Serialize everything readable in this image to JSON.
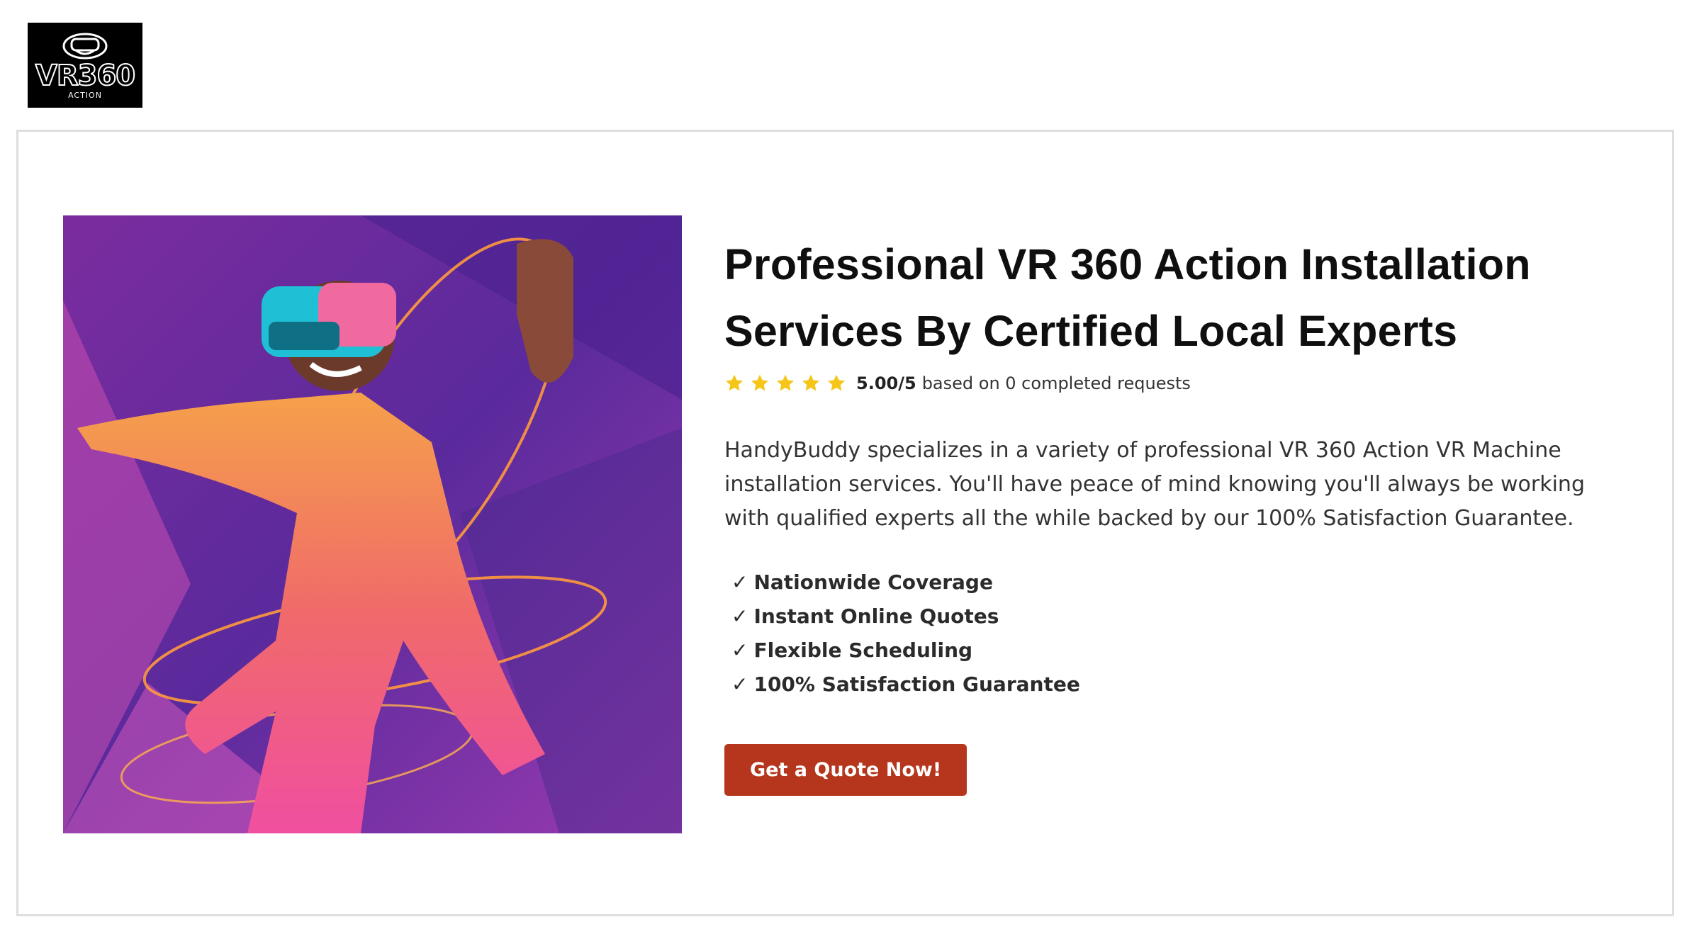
{
  "logo": {
    "mark": "VR360",
    "sub": "ACTION",
    "icon": "vr-headset-icon"
  },
  "hero": {
    "image_description_icon": "vr-dancer-image"
  },
  "content": {
    "headline_line1": "Professional VR 360 Action Installation",
    "headline_line2": "Services By Certified Local Experts",
    "rating": {
      "stars": 5,
      "score": "5.00/5",
      "suffix": "based on 0 completed requests",
      "star_color": "#f5c518"
    },
    "description": "HandyBuddy specializes in a variety of professional VR 360 Action VR Machine installation services. You'll have peace of mind knowing you'll always be working with qualified experts all the while backed by our 100% Satisfaction Guarantee.",
    "features": [
      {
        "check": "✓",
        "label": "Nationwide Coverage"
      },
      {
        "check": "✓",
        "label": "Instant Online Quotes"
      },
      {
        "check": "✓",
        "label": "Flexible Scheduling"
      },
      {
        "check": "✓",
        "label": "100% Satisfaction Guarantee"
      }
    ],
    "cta_label": "Get a Quote Now!",
    "cta_color": "#b5361c"
  }
}
